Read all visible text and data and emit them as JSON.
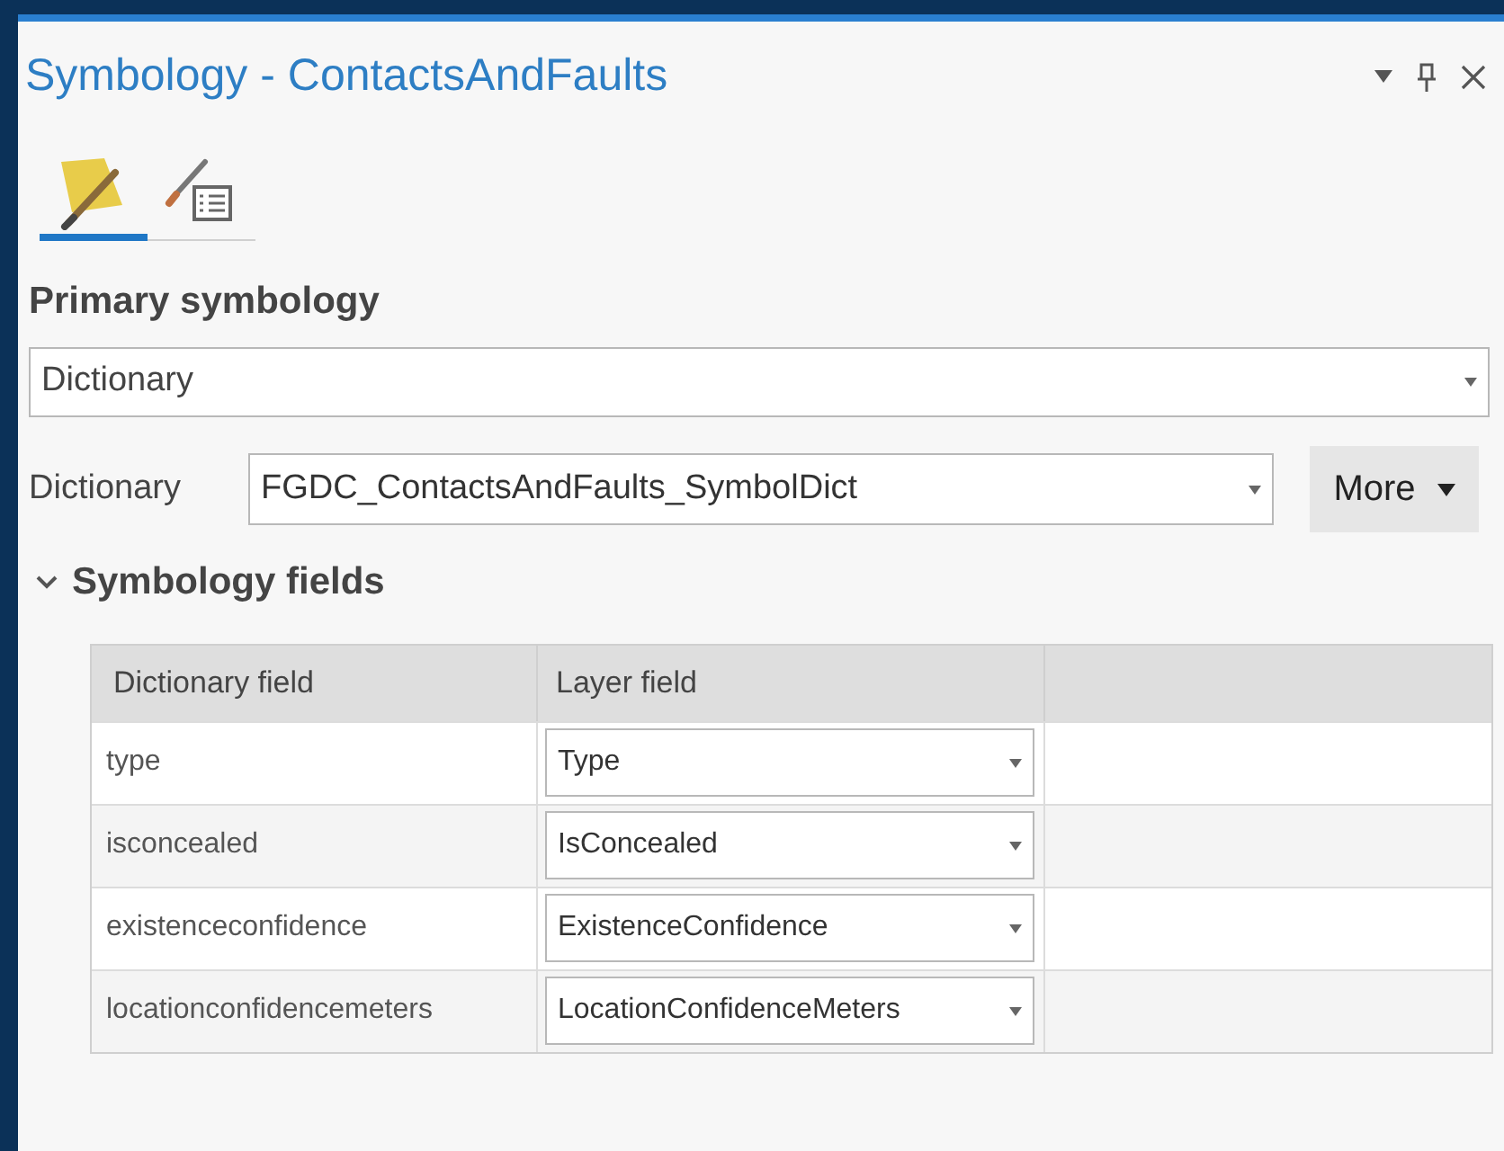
{
  "window": {
    "title": "Symbology - ContactsAndFaults"
  },
  "tabs": [
    {
      "kind": "primary",
      "selected": true
    },
    {
      "kind": "properties",
      "selected": false
    }
  ],
  "primary_symbology": {
    "label": "Primary symbology",
    "value": "Dictionary"
  },
  "dictionary": {
    "label": "Dictionary",
    "value": "FGDC_ContactsAndFaults_SymbolDict",
    "more_button": "More"
  },
  "symbology_fields": {
    "title": "Symbology fields",
    "expanded": true,
    "columns": [
      "Dictionary field",
      "Layer field"
    ],
    "rows": [
      {
        "dictionary_field": "type",
        "layer_field": "Type"
      },
      {
        "dictionary_field": "isconcealed",
        "layer_field": "IsConcealed"
      },
      {
        "dictionary_field": "existenceconfidence",
        "layer_field": "ExistenceConfidence"
      },
      {
        "dictionary_field": "locationconfidencemeters",
        "layer_field": "LocationConfidenceMeters"
      }
    ]
  }
}
